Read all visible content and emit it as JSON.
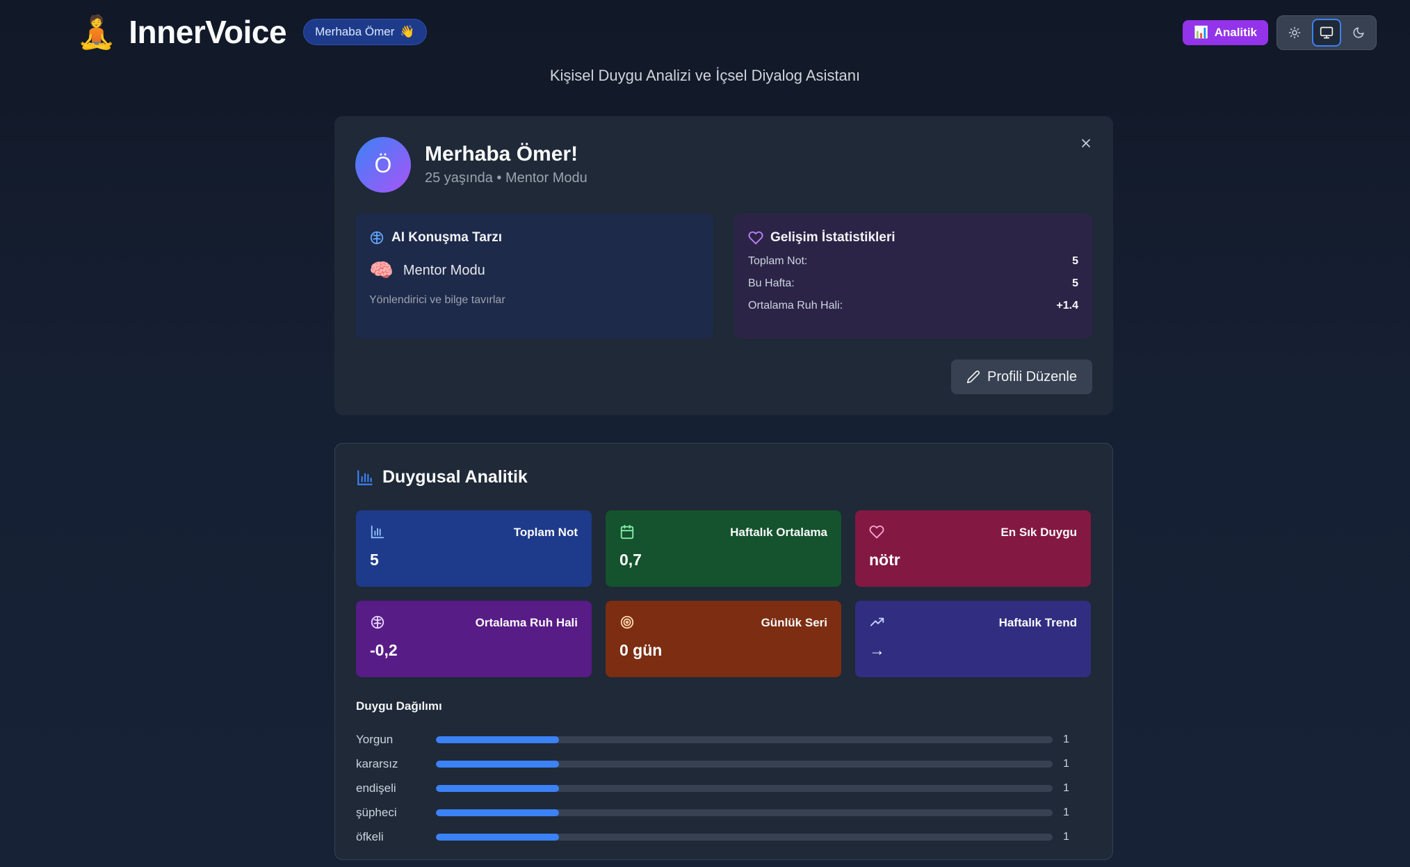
{
  "header": {
    "logo_emoji": "🧘",
    "app_name": "InnerVoice",
    "greeting_badge": "Merhaba Ömer",
    "greeting_emoji": "👋",
    "subtitle": "Kişisel Duygu Analizi ve İçsel Diyalog Asistanı",
    "analytics_button": "Analitik",
    "analytics_emoji": "📊",
    "theme_options": [
      "sun-icon",
      "monitor-icon",
      "moon-icon"
    ],
    "theme_selected": "monitor-icon"
  },
  "profile": {
    "avatar_initial": "Ö",
    "title": "Merhaba Ömer!",
    "subtitle": "25 yaşında • Mentor Modu",
    "ai_style": {
      "heading": "AI Konuşma Tarzı",
      "mode_emoji": "🧠",
      "mode_name": "Mentor Modu",
      "description": "Yönlendirici ve bilge tavırlar"
    },
    "stats": {
      "heading": "Gelişim İstatistikleri",
      "rows": [
        {
          "label": "Toplam Not:",
          "value": "5"
        },
        {
          "label": "Bu Hafta:",
          "value": "5"
        },
        {
          "label": "Ortalama Ruh Hali:",
          "value": "+1.4"
        }
      ]
    },
    "edit_button": "Profili Düzenle"
  },
  "analytics": {
    "title": "Duygusal Analitik",
    "tiles": [
      {
        "icon": "bar-chart-icon",
        "label": "Toplam Not",
        "value": "5",
        "color": "#1e3a8a"
      },
      {
        "icon": "calendar-icon",
        "label": "Haftalık Ortalama",
        "value": "0,7",
        "color": "#14532d"
      },
      {
        "icon": "heart-icon",
        "label": "En Sık Duygu",
        "value": "nötr",
        "color": "#831843"
      },
      {
        "icon": "brain-icon",
        "label": "Ortalama Ruh Hali",
        "value": "-0,2",
        "color": "#581c87"
      },
      {
        "icon": "target-icon",
        "label": "Günlük Seri",
        "value": "0 gün",
        "color": "#7c2d12"
      },
      {
        "icon": "trending-up-icon",
        "label": "Haftalık Trend",
        "value": "→",
        "color": "#312e81"
      }
    ],
    "distribution_title": "Duygu Dağılımı",
    "distribution": [
      {
        "label": "Yorgun",
        "count": "1",
        "fraction": 0.2
      },
      {
        "label": "kararsız",
        "count": "1",
        "fraction": 0.2
      },
      {
        "label": "endişeli",
        "count": "1",
        "fraction": 0.2
      },
      {
        "label": "şüpheci",
        "count": "1",
        "fraction": 0.2
      },
      {
        "label": "öfkeli",
        "count": "1",
        "fraction": 0.2
      }
    ],
    "accent": "#3b82f6"
  }
}
